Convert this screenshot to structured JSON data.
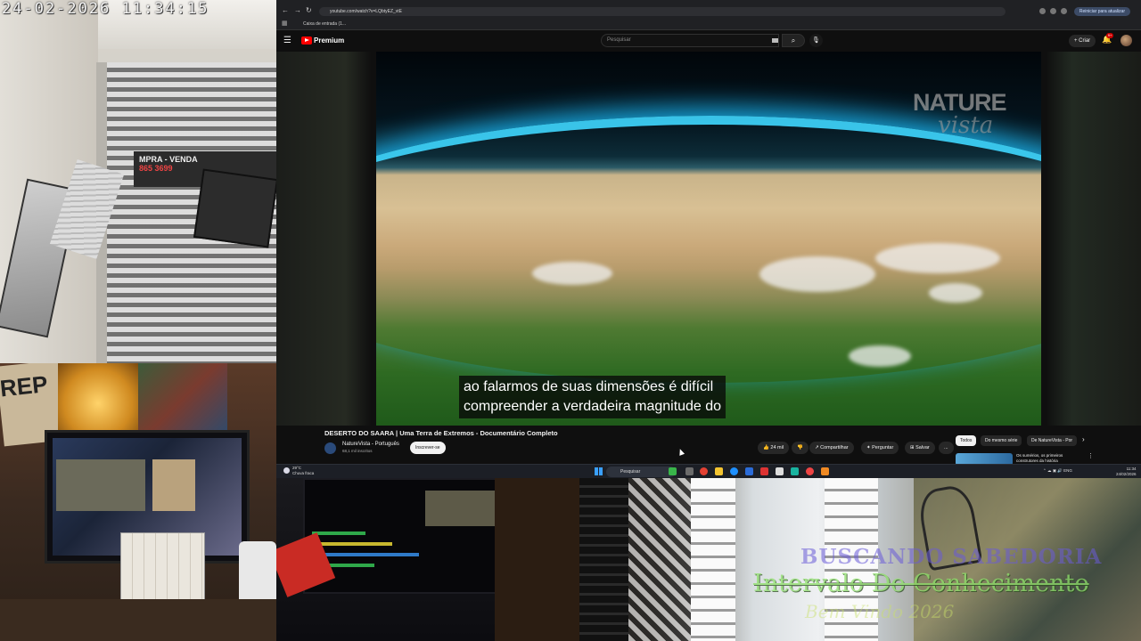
{
  "camera": {
    "timestamp": "24-02-2026 11:34:15",
    "gate_sign": {
      "line1": "MPRA - VENDA",
      "line2": "865 3699"
    }
  },
  "desk_sign": "REP",
  "overlay": {
    "line1": "BUSCANDO SABEDORIA",
    "line2": "Intervalo Do Conhecimento",
    "line3": "Bem Vindo 2026"
  },
  "browser": {
    "url": "youtube.com/watch?v=LQbtyEZ_vtE",
    "bookmark": "Caixa de entrada (1...",
    "update_button": "Reiniciar para atualizar"
  },
  "youtube": {
    "brand": "Premium",
    "search_placeholder": "Pesquisar",
    "create_label": "Criar",
    "notif_count": "9+",
    "video": {
      "watermark_line1": "NATURE",
      "watermark_line2": "vista",
      "subtitle_line1": "ao falarmos de suas dimensões é difícil",
      "subtitle_line2": "compreender a verdadeira magnitude do"
    },
    "title": "DESERTO DO SAARA | Uma Terra de Extremos - Documentário Completo",
    "channel": {
      "name": "NatureVista - Português",
      "subscribers": "68,1 mil inscritos",
      "subscribe_label": "Inscrever-se"
    },
    "actions": {
      "likes": "24 mil",
      "share": "Compartilhar",
      "ask": "Perguntar",
      "save": "Salvar",
      "more": "..."
    },
    "chips": [
      "Todos",
      "Do mesmo série",
      "De NatureVista - Por"
    ],
    "recommended_title": "Os sumérios, os primeiros construtores da história"
  },
  "taskbar": {
    "weather_temp": "29°C",
    "weather_desc": "Chuva fraca",
    "search": "Pesquisar",
    "lang": "ENG",
    "time": "11:34",
    "date": "24/02/2026"
  }
}
